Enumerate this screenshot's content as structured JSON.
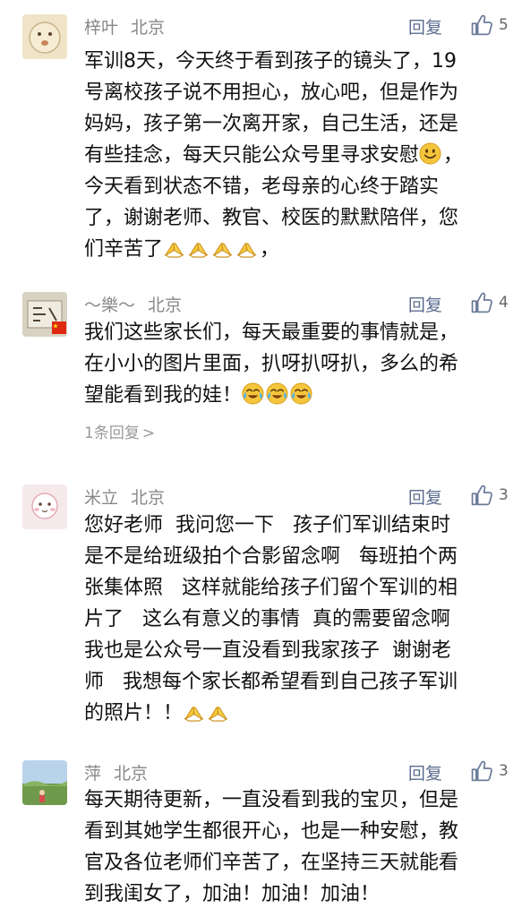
{
  "comments": [
    {
      "name": "梓叶",
      "location": "北京",
      "reply_label": "回复",
      "likes": "5",
      "lines": [
        "军训8天，今天终于看到孩子的镜头了，19",
        "号离校孩子说不用担心，放心吧，但是作为",
        "妈妈，孩子第一次离开家，自己生活，还是",
        "有些挂念，每天只能公众号里寻求安慰",
        "今天看到状态不错，老母亲的心终于踏实",
        "了，谢谢老师、教官、校医的默默陪伴，您",
        "们辛苦了",
        "，"
      ],
      "emoji": [
        "smile",
        "pray",
        "pray",
        "pray",
        "pray"
      ]
    },
    {
      "name": "～樂～",
      "location": "北京",
      "reply_label": "回复",
      "likes": "4",
      "lines": [
        "我们这些家长们，每天最重要的事情就是，",
        "在小小的图片里面，扒呀扒呀扒，多么的希",
        "望能看到我的娃！"
      ],
      "emoji": [
        "cry",
        "cry",
        "cry"
      ],
      "more_replies": "1条回复",
      "more_replies_chevron": ">"
    },
    {
      "name": "米立",
      "location": "北京",
      "reply_label": "回复",
      "likes": "3",
      "lines": [
        "您好老师  我问您一下   孩子们军训结束时",
        "是不是给班级拍个合影留念啊   每班拍个两",
        "张集体照   这样就能给孩子们留个军训的相",
        "片了   这么有意义的事情  真的需要留念啊",
        "我也是公众号一直没看到我家孩子  谢谢老",
        "师   我想每个家长都希望看到自己孩子军训",
        "的照片！！"
      ],
      "emoji": [
        "pray",
        "pray"
      ]
    },
    {
      "name": "萍",
      "location": "北京",
      "reply_label": "回复",
      "likes": "3",
      "lines": [
        "每天期待更新，一直没看到我的宝贝，但是",
        "看到其她学生都很开心，也是一种安慰，教",
        "官及各位老师们辛苦了，在坚持三天就能看",
        "到我闺女了，加油！加油！加油！"
      ],
      "emoji": []
    }
  ],
  "colors": {
    "name": "#888888",
    "reply": "#5b6d8f",
    "text": "#111111",
    "emoji_yellow": "#f5c63c"
  },
  "icons": [
    "thumbs-up-icon",
    "smile-emoji-icon",
    "pray-emoji-icon",
    "cry-laugh-emoji-icon",
    "china-flag-icon"
  ]
}
